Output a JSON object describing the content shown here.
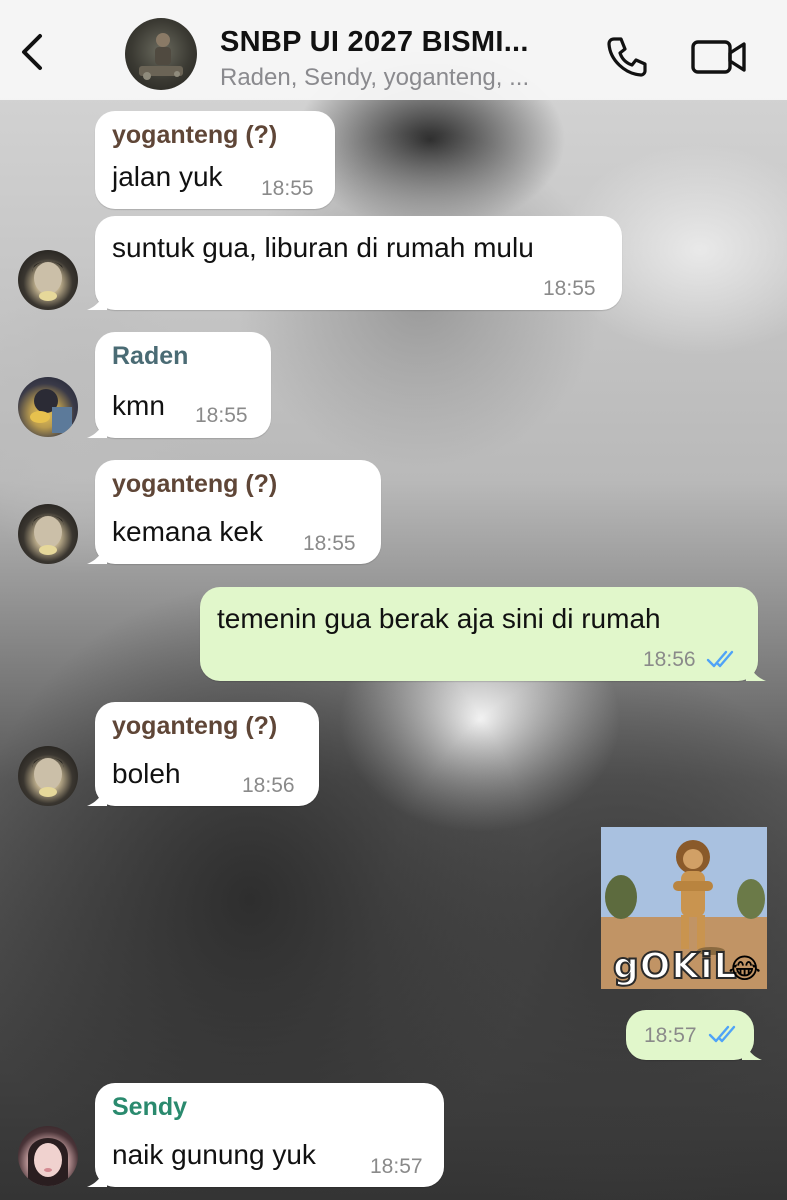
{
  "header": {
    "back_icon": "chevron-left-icon",
    "title": "SNBP UI 2027 BISMI...",
    "subtitle": "Raden, Sendy, yoganteng, ...",
    "call_icon": "phone-icon",
    "video_icon": "video-camera-icon"
  },
  "messages": [
    {
      "sender": "yoganteng (?)",
      "text": "jalan yuk",
      "time": "18:55",
      "direction": "incoming"
    },
    {
      "sender": "",
      "text": "suntuk gua, liburan di rumah mulu",
      "time": "18:55",
      "direction": "incoming"
    },
    {
      "sender": "Raden",
      "text": "kmn",
      "time": "18:55",
      "direction": "incoming"
    },
    {
      "sender": "yoganteng (?)",
      "text": "kemana kek",
      "time": "18:55",
      "direction": "incoming"
    },
    {
      "sender": "",
      "text": "temenin gua berak aja sini di rumah",
      "time": "18:56",
      "direction": "outgoing",
      "status": "read"
    },
    {
      "sender": "yoganteng (?)",
      "text": "boleh",
      "time": "18:56",
      "direction": "incoming"
    },
    {
      "sender": "",
      "text": "",
      "time": "18:57",
      "direction": "outgoing",
      "status": "read",
      "sticker_text": "gOKiL",
      "sticker_emoji": "😂"
    },
    {
      "sender": "Sendy",
      "text": "naik gunung yuk",
      "time": "18:57",
      "direction": "incoming"
    }
  ],
  "colors": {
    "incoming_bubble": "#ffffff",
    "outgoing_bubble": "#e1f7cb",
    "read_ticks": "#4fa3f7",
    "sender_yoganteng": "#5f4637",
    "sender_raden": "#4a6b74",
    "sender_sendy": "#2a8a6e"
  }
}
